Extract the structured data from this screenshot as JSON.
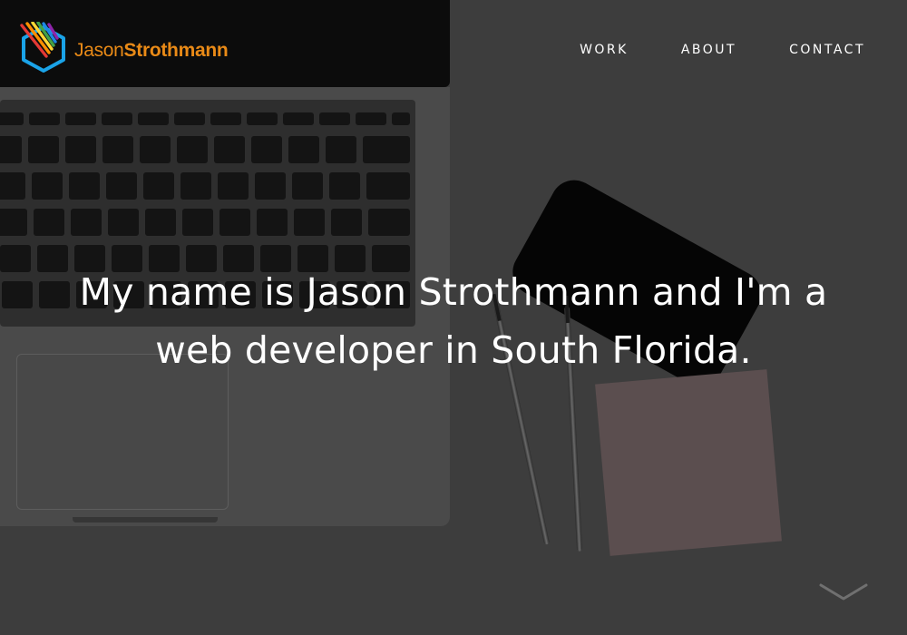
{
  "brand": {
    "first_name": "Jason",
    "last_name": "Strothmann",
    "colors": {
      "orange": "#e98a17",
      "blue": "#1aa3e8",
      "accent_stripes": [
        "#e53935",
        "#ff8f00",
        "#fdd835",
        "#43a047",
        "#1e88e5",
        "#8e24aa"
      ]
    }
  },
  "nav": {
    "items": [
      {
        "label": "WORK"
      },
      {
        "label": "ABOUT"
      },
      {
        "label": "CONTACT"
      }
    ]
  },
  "hero": {
    "headline_line1": "My name is Jason Strothmann and I'm a",
    "headline_line2": "web developer in South Florida.",
    "scroll_icon": "chevron-down-icon"
  }
}
